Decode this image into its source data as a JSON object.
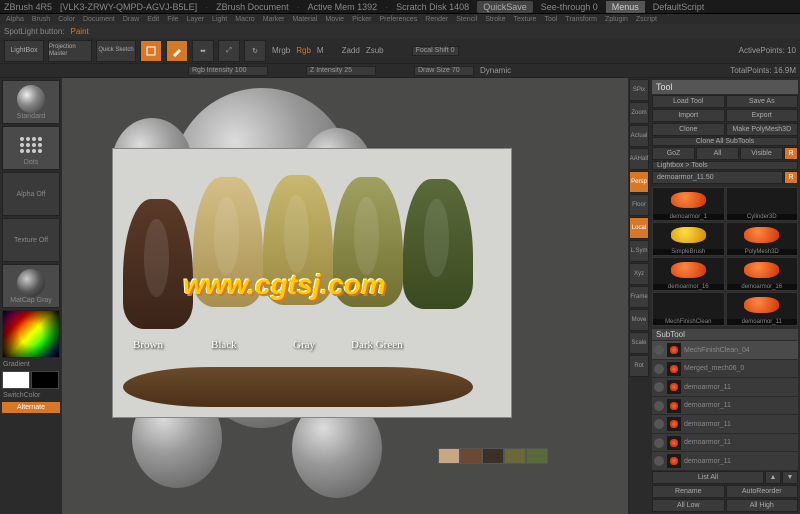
{
  "title": {
    "app": "ZBrush 4R5",
    "doc": "[VLK3-ZRWY-QMPD-AGVJ-B5LE]",
    "label": "ZBrush Document",
    "mem": "Active Mem 1392",
    "scratch": "Scratch Disk 1408",
    "quicksave": "QuickSave",
    "seethrough": "See-through 0",
    "menus": "Menus",
    "script": "DefaultScript"
  },
  "spotlight": {
    "label": "SpotLight button:",
    "mode": "Paint"
  },
  "menu": [
    "Alpha",
    "Brush",
    "Color",
    "Document",
    "Draw",
    "Edit",
    "File",
    "Layer",
    "Light",
    "Macro",
    "Marker",
    "Material",
    "Movie",
    "Picker",
    "Preferences",
    "Render",
    "Stencil",
    "Stroke",
    "Texture",
    "Tool",
    "Transform",
    "Zplugin",
    "Zscript"
  ],
  "toolbar": {
    "lightbox": "LightBox",
    "projmaster": "Projection\nMaster",
    "quicksketch": "Quick\nSketch",
    "edit": "Edit",
    "draw": "Draw",
    "move": "Move",
    "scale": "Scale",
    "rotate": "Rotate",
    "mrgb": "Mrgb",
    "rgb": "Rgb",
    "m": "M",
    "rgbint": "Rgb Intensity 100",
    "zadd": "Zadd",
    "zsub": "Zsub",
    "zint": "Z Intensity 25",
    "focal": "Focal Shift 0",
    "drawsize": "Draw Size 70",
    "activepts": "ActivePoints: 10",
    "totalpts": "TotalPoints: 16.9M",
    "dynamic": "Dynamic"
  },
  "left": {
    "standard": "Standard",
    "dots": "Dots",
    "alphaoff": "Alpha Off",
    "textureoff": "Texture Off",
    "matcap": "MatCap Gray",
    "gradient": "Gradient",
    "switch": "SwitchColor",
    "alternate": "Alternate"
  },
  "rstrip": {
    "spix": "SPix",
    "zoom": "Zoom",
    "actual": "Actual",
    "aahalf": "AAHalf",
    "persp": "Persp",
    "floor": "Floor",
    "local": "Local",
    "lsym": "L.Sym",
    "xyz": "Xyz",
    "frame": "Frame",
    "move": "Move",
    "scale": "Scale",
    "rotate": "Rot"
  },
  "tool": {
    "title": "Tool",
    "load": "Load Tool",
    "saveas": "Save As",
    "import": "Import",
    "export": "Export",
    "clone": "Clone",
    "makepoly": "Make PolyMesh3D",
    "cloneall": "Clone All SubTools",
    "goz": "GoZ",
    "all": "All",
    "visible": "Visible",
    "r": "R",
    "lightbox": "Lightbox > Tools",
    "current": "demoarmor_11.50",
    "thumbs": [
      {
        "label": "demoarmor_1"
      },
      {
        "label": "Cylinder3D"
      },
      {
        "label": "SimpleBrush",
        "s": true
      },
      {
        "label": "PolyMesh3D"
      },
      {
        "label": "demoarmor_16"
      },
      {
        "label": "demoarmor_16"
      },
      {
        "label": "MechFinishClean"
      },
      {
        "label": "demoarmor_11"
      }
    ],
    "subtool": "SubTool",
    "subitems": [
      "MechFinishClean_04",
      "Merged_mech06_0",
      "demoarmor_11",
      "demoarmor_11",
      "demoarmor_11",
      "demoarmor_11",
      "demoarmor_11"
    ],
    "listall": "List All",
    "rename": "Rename",
    "autoreorder": "AutoReorder",
    "alllow": "All Low",
    "allhigh": "All High"
  },
  "photo": {
    "labels": {
      "brown": "Brown",
      "black": "Black",
      "gray": "Gray",
      "dkgreen": "Dark Green"
    },
    "wm": "www.cgtsj.com"
  },
  "palette": [
    "#c8a884",
    "#6a4832",
    "#3a3028",
    "#6a6838",
    "#5a6a3a"
  ]
}
